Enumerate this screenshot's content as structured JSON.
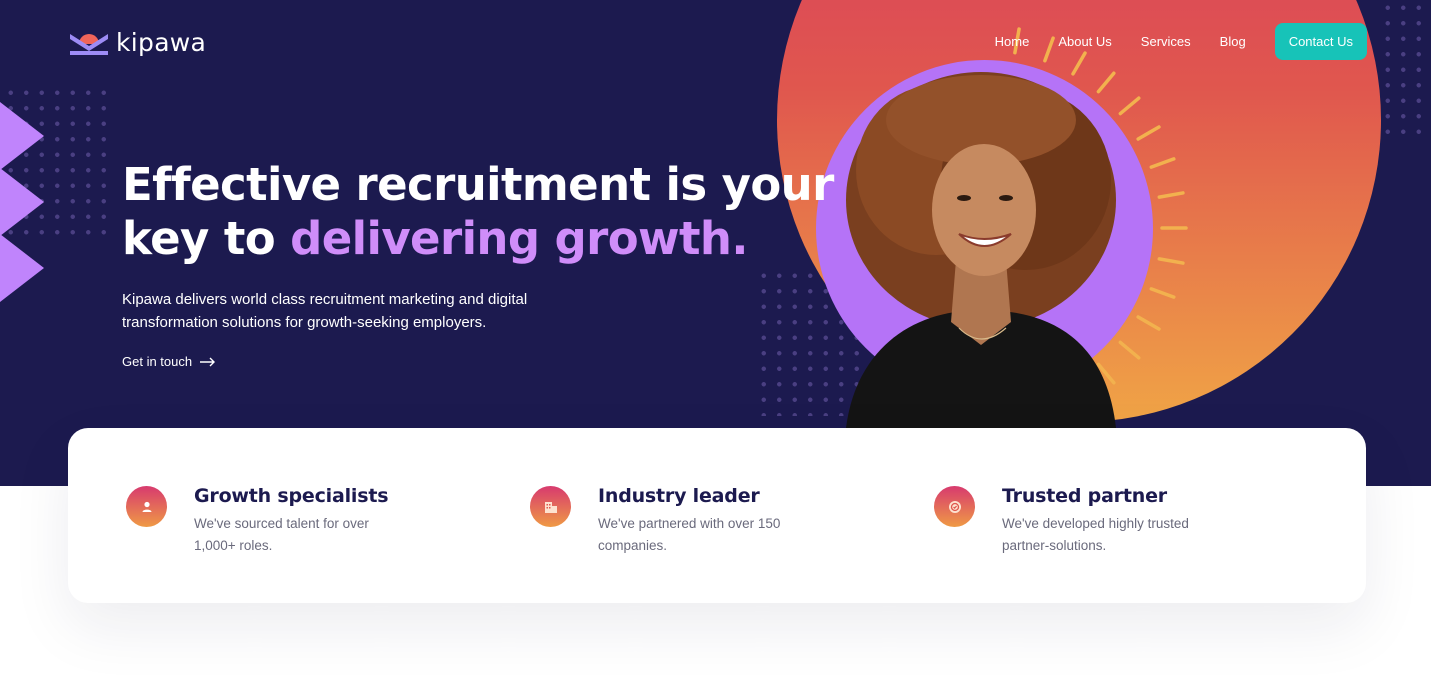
{
  "brand": {
    "name": "kipawa"
  },
  "nav": {
    "items": [
      "Home",
      "About Us",
      "Services",
      "Blog"
    ],
    "cta_label": "Contact Us"
  },
  "hero": {
    "headline_line1": "Effective recruitment is your",
    "headline_line2_plain": "key to ",
    "headline_line2_accent": "delivering growth.",
    "lede": "Kipawa delivers world class recruitment marketing and digital transformation solutions for growth-seeking employers.",
    "link_label": "Get in touch"
  },
  "features": [
    {
      "title": "Growth specialists",
      "text": "We've sourced talent for over 1,000+ roles.",
      "icon": "user-icon"
    },
    {
      "title": "Industry leader",
      "text": "We've partnered with over 150 companies.",
      "icon": "building-icon"
    },
    {
      "title": "Trusted partner",
      "text": "We've developed highly trusted partner-solutions.",
      "icon": "badge-icon"
    }
  ],
  "colors": {
    "background": "#1c1a4f",
    "accent_purple": "#cf8df9",
    "cta_teal": "#17c3b8",
    "gradient_top": "#d73a62",
    "gradient_bottom": "#f0a446"
  }
}
